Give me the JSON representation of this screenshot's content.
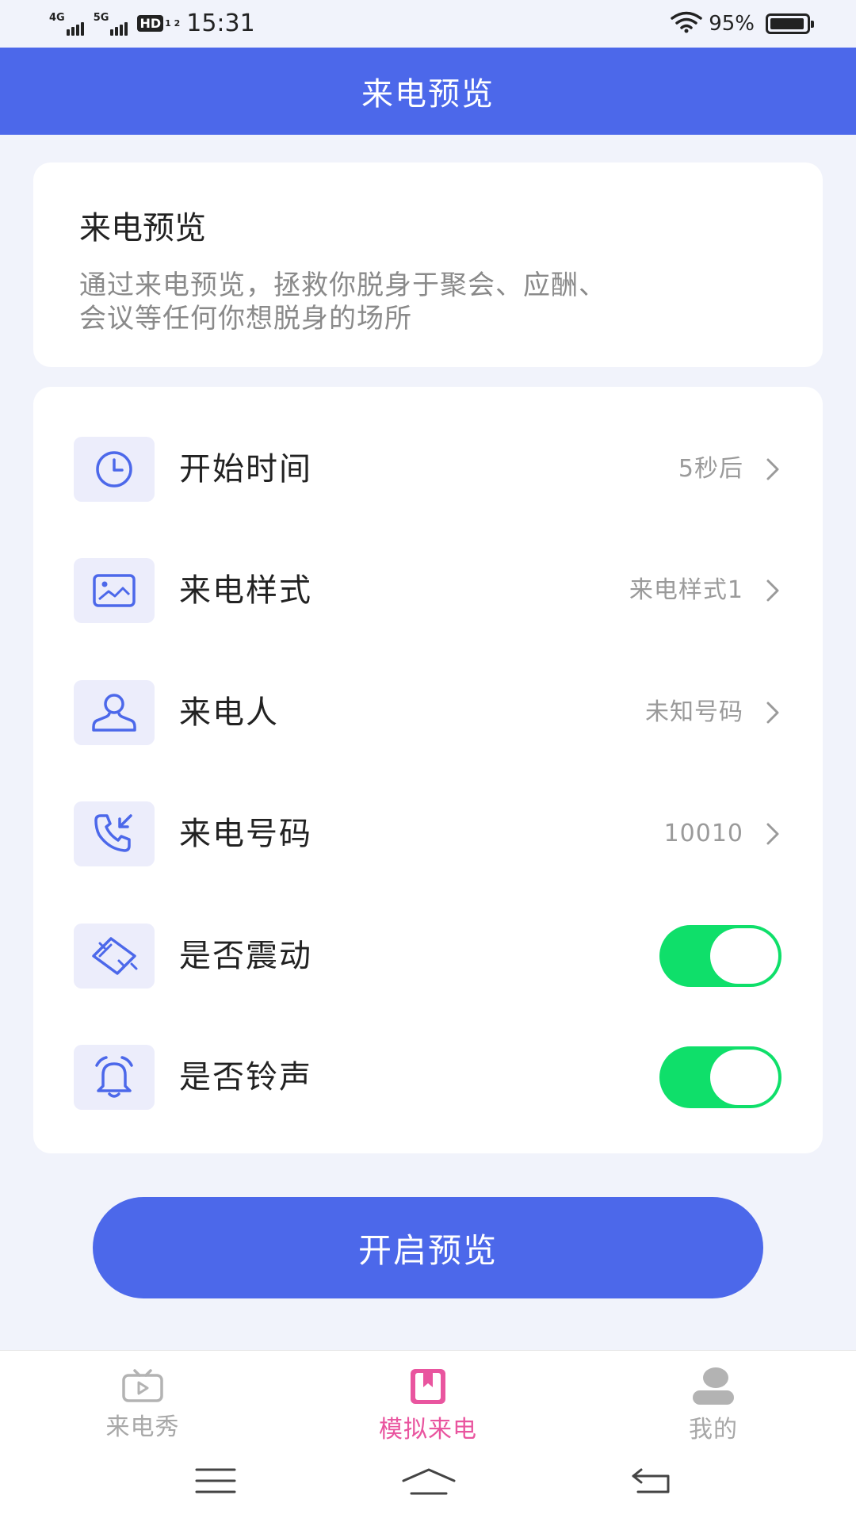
{
  "status_bar": {
    "network_1": "4G",
    "network_2": "5G",
    "hd": "HD",
    "hd_sub": "1 2",
    "time": "15:31",
    "battery_percent": "95%",
    "battery_level": 0.95
  },
  "header": {
    "title": "来电预览"
  },
  "intro": {
    "title": "来电预览",
    "description_line1": "通过来电预览，拯救你脱身于聚会、应酬、",
    "description_line2": "会议等任何你想脱身的场所"
  },
  "settings": [
    {
      "icon": "clock-icon",
      "label": "开始时间",
      "value": "5秒后",
      "type": "select"
    },
    {
      "icon": "image-icon",
      "label": "来电样式",
      "value": "来电样式1",
      "type": "select"
    },
    {
      "icon": "person-icon",
      "label": "来电人",
      "value": "未知号码",
      "type": "select"
    },
    {
      "icon": "incoming-call-icon",
      "label": "来电号码",
      "value": "10010",
      "type": "select"
    },
    {
      "icon": "vibrate-icon",
      "label": "是否震动",
      "enabled": true,
      "type": "toggle"
    },
    {
      "icon": "bell-icon",
      "label": "是否铃声",
      "enabled": true,
      "type": "toggle"
    }
  ],
  "primary_button": {
    "label": "开启预览"
  },
  "bottom_nav": [
    {
      "icon": "tv-play-icon",
      "label": "来电秀",
      "active": false
    },
    {
      "icon": "bookmark-book-icon",
      "label": "模拟来电",
      "active": true
    },
    {
      "icon": "profile-icon",
      "label": "我的",
      "active": false
    }
  ],
  "colors": {
    "primary": "#4c68ea",
    "toggle_on": "#0fdf6a",
    "active_tab": "#e9559f",
    "background": "#f1f3fb"
  }
}
